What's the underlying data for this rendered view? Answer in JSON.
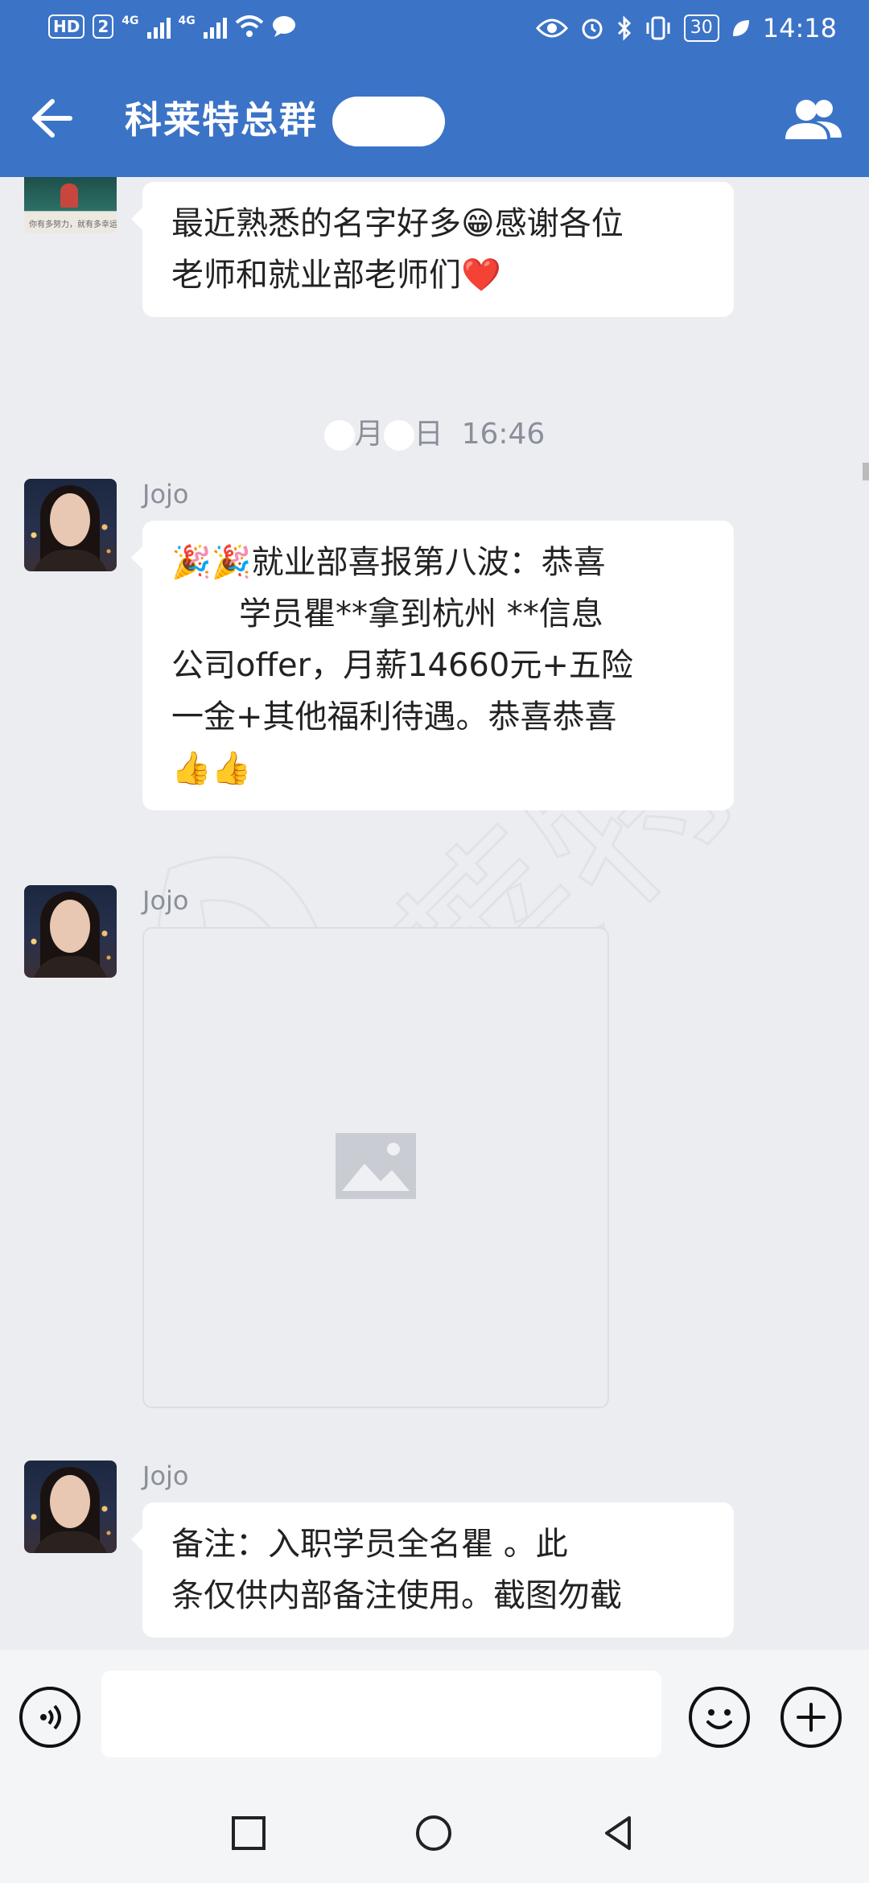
{
  "status_bar": {
    "hd_label": "HD",
    "sim_label": "2",
    "network_1": "4G",
    "network_2": "4G",
    "battery": "30",
    "time": "14:18"
  },
  "header": {
    "title": "科莱特总群",
    "back_icon": "back-arrow-icon",
    "members_icon": "group-members-icon"
  },
  "messages": [
    {
      "type": "text",
      "lines": [
        "最近熟悉的名字好多😁感谢各位",
        "老师和就业部老师们❤️"
      ]
    },
    {
      "type": "timestamp",
      "month_suffix": "月",
      "day_suffix": "日",
      "time": "16:46"
    },
    {
      "type": "text",
      "sender": "Jojo",
      "lines": [
        "🎉🎉就业部喜报第八波：恭喜",
        "学员瞿**拿到杭州   **信息",
        "公司offer，月薪14660元+五险",
        "一金+其他福利待遇。恭喜恭喜",
        "👍👍"
      ]
    },
    {
      "type": "image",
      "sender": "Jojo"
    },
    {
      "type": "text",
      "sender": "Jojo",
      "lines": [
        "备注：入职学员全名瞿       。此",
        "条仅供内部备注使用。截图勿截"
      ]
    }
  ],
  "watermark_text": "科莱特",
  "watermark_logo_text": "KELOTE",
  "input_bar": {
    "voice_icon": "voice-input-icon",
    "text_value": "",
    "emoji_icon": "emoji-icon",
    "plus_icon": "more-plus-icon"
  },
  "nav_bar": {
    "recents_icon": "square-recents-icon",
    "home_icon": "circle-home-icon",
    "back_icon": "triangle-back-icon"
  },
  "colors": {
    "header_blue": "#3b73c7",
    "chat_bg": "#ebedf1",
    "bubble_bg": "#ffffff",
    "meta_text": "#8a8f99"
  }
}
